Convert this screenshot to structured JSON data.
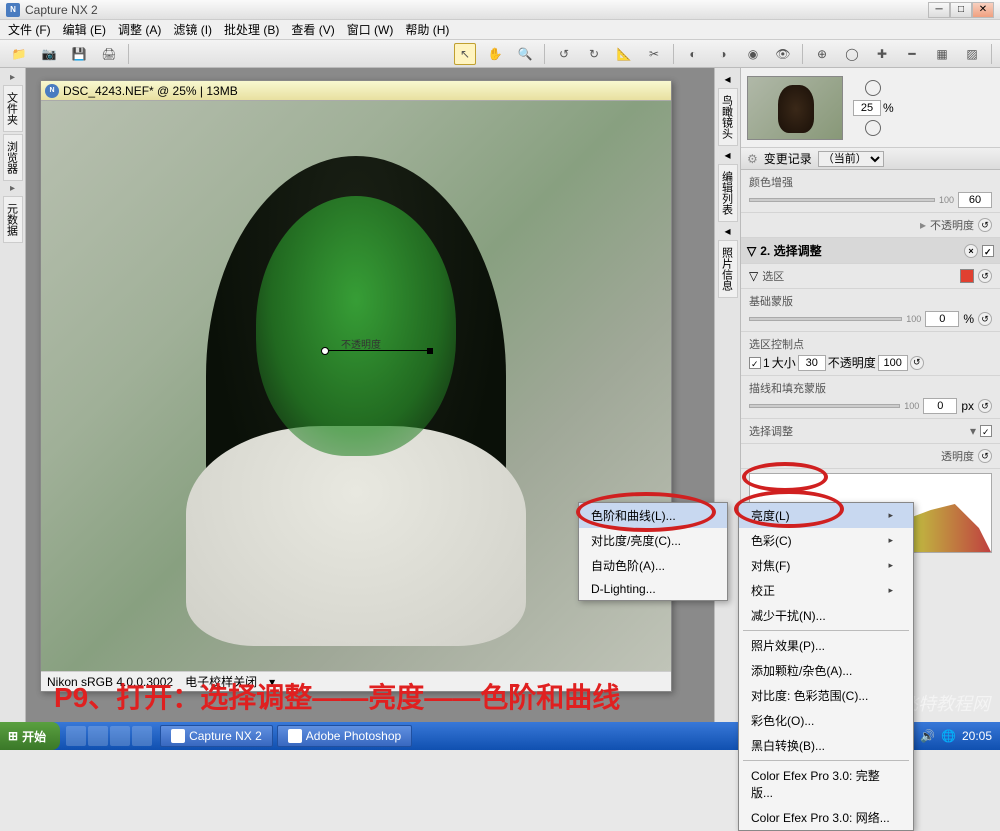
{
  "app": {
    "title": "Capture NX 2"
  },
  "menu": {
    "file": "文件 (F)",
    "edit": "编辑 (E)",
    "adjust": "调整 (A)",
    "filter": "滤镜 (I)",
    "batch": "批处理 (B)",
    "view": "查看 (V)",
    "window": "窗口 (W)",
    "help": "帮助 (H)"
  },
  "leftTabs": {
    "folders": "文件夹",
    "browser": "浏览器",
    "meta": "元数据"
  },
  "rightTabs": {
    "birdseye": "鸟瞰镜头",
    "editlist": "编辑列表",
    "photoinfo": "照片信息"
  },
  "doc": {
    "title": "DSC_4243.NEF* @ 25% | 13MB",
    "colorProfile": "Nikon sRGB 4.0.0.3002",
    "softproof": "电子校样关闭",
    "controlLabel": "不透明度"
  },
  "nav": {
    "zoom": "25",
    "pct": "%"
  },
  "editPanel": {
    "historyLabel": "变更记录",
    "historyCurrent": "（当前）",
    "colorBoost": "颜色增强",
    "colorBoostVal": "60",
    "opacity": "不透明度",
    "step2": "2. 选择调整",
    "selection": "选区",
    "baseMask": "基础蒙版",
    "baseMaskVal": "0",
    "baseMaskMax": "100",
    "pctUnit": "%",
    "ctrlPoints": "选区控制点",
    "cpIndex": "1",
    "cpSize": "大小",
    "cpSizeVal": "30",
    "cpOpacity": "不透明度",
    "cpOpacityVal": "100",
    "strokeMask": "描线和填充蒙版",
    "strokeVal": "0",
    "strokeMax": "100",
    "pxUnit": "px",
    "selAdjust": "选择调整",
    "opacity2": "透明度"
  },
  "submenu": {
    "levels": "色阶和曲线(L)...",
    "contrast": "对比度/亮度(C)...",
    "autolevels": "自动色阶(A)...",
    "dlighting": "D-Lighting..."
  },
  "mainmenu": {
    "brightness": "亮度(L)",
    "color": "色彩(C)",
    "focus": "对焦(F)",
    "correction": "校正",
    "noise": "减少干扰(N)...",
    "photoeffect": "照片效果(P)...",
    "grain": "添加颗粒/杂色(A)...",
    "contrastrange": "对比度: 色彩范围(C)...",
    "colorize": "彩色化(O)...",
    "bw": "黑白转换(B)...",
    "efex2": "Color Efex Pro 3.0: 完整版...",
    "efex3": "Color Efex Pro 3.0: 网络..."
  },
  "annotation": "P9、打开：选择调整——亮度——色阶和曲线",
  "taskbar": {
    "start": "开始",
    "app1": "Capture NX 2",
    "app2": "Adobe Photoshop",
    "time": "20:05"
  },
  "watermark": "飞特教程网"
}
